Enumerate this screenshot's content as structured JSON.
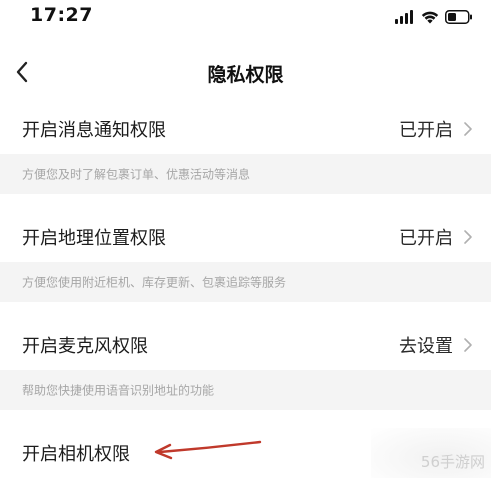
{
  "status_bar": {
    "time": "17:27",
    "icons": [
      "signal-icon",
      "wifi-icon",
      "battery-icon"
    ]
  },
  "nav": {
    "title": "隐私权限",
    "back_icon": "chevron-left-icon"
  },
  "permissions": [
    {
      "label": "开启消息通知权限",
      "status": "已开启",
      "description": "方便您及时了解包裹订单、优惠活动等消息"
    },
    {
      "label": "开启地理位置权限",
      "status": "已开启",
      "description": "方便您使用附近柜机、库存更新、包裹追踪等服务"
    },
    {
      "label": "开启麦克风权限",
      "status": "去设置",
      "description": "帮助您快捷使用语音识别地址的功能"
    },
    {
      "label": "开启相机权限",
      "status": "",
      "description": ""
    }
  ],
  "annotation": {
    "arrow_color": "#c0392b"
  },
  "watermark": {
    "text": "56手游网"
  },
  "colors": {
    "background": "#ffffff",
    "description_bg": "#f4f4f4",
    "description_text": "#a6a6a6",
    "chevron": "#b0b0b0"
  }
}
